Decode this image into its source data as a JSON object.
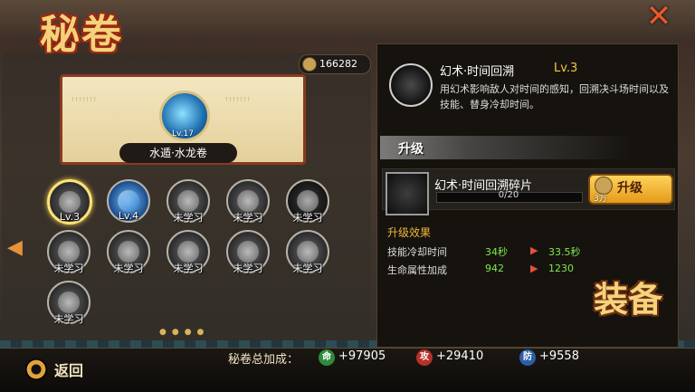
{
  "header": {
    "title": "秘卷",
    "close_icon": "close-x-icon"
  },
  "currency": {
    "amount": "166282",
    "icon": "coin-icon"
  },
  "scroll": {
    "name": "水遁·水龙卷",
    "level": "Lv.17"
  },
  "skills": [
    {
      "label": "Lv.3",
      "state": "selected"
    },
    {
      "label": "Lv.4",
      "state": "learned"
    },
    {
      "label": "未学习",
      "state": "locked"
    },
    {
      "label": "未学习",
      "state": "locked"
    },
    {
      "label": "未学习",
      "state": "locked"
    },
    {
      "label": "未学习",
      "state": "locked"
    },
    {
      "label": "未学习",
      "state": "locked"
    },
    {
      "label": "未学习",
      "state": "locked"
    },
    {
      "label": "未学习",
      "state": "locked"
    },
    {
      "label": "未学习",
      "state": "locked"
    },
    {
      "label": "未学习",
      "state": "locked"
    }
  ],
  "detail": {
    "name": "幻术·时间回溯",
    "level": "Lv.3",
    "description": "用幻术影响敌人对时间的感知，回溯决斗场时间以及技能、替身冷却时间。",
    "upgrade_heading": "升级",
    "fragment_name": "幻术·时间回溯碎片",
    "fragment_count": "0/20",
    "upgrade_button": "升级",
    "cost": "3万",
    "effects_heading": "升级效果",
    "effects": [
      {
        "label": "技能冷却时间",
        "from": "34秒",
        "to": "33.5秒"
      },
      {
        "label": "生命属性加成",
        "from": "942",
        "to": "1230"
      }
    ]
  },
  "footer": {
    "back_label": "返回",
    "bonus_label": "秘卷总加成：",
    "bonuses": [
      {
        "badge": "命",
        "value": "+97905",
        "color": "#2f8a3a"
      },
      {
        "badge": "攻",
        "value": "+29410",
        "color": "#b8302a"
      },
      {
        "badge": "防",
        "value": "+9558",
        "color": "#2c5fa8"
      }
    ],
    "equip_label": "装备"
  }
}
